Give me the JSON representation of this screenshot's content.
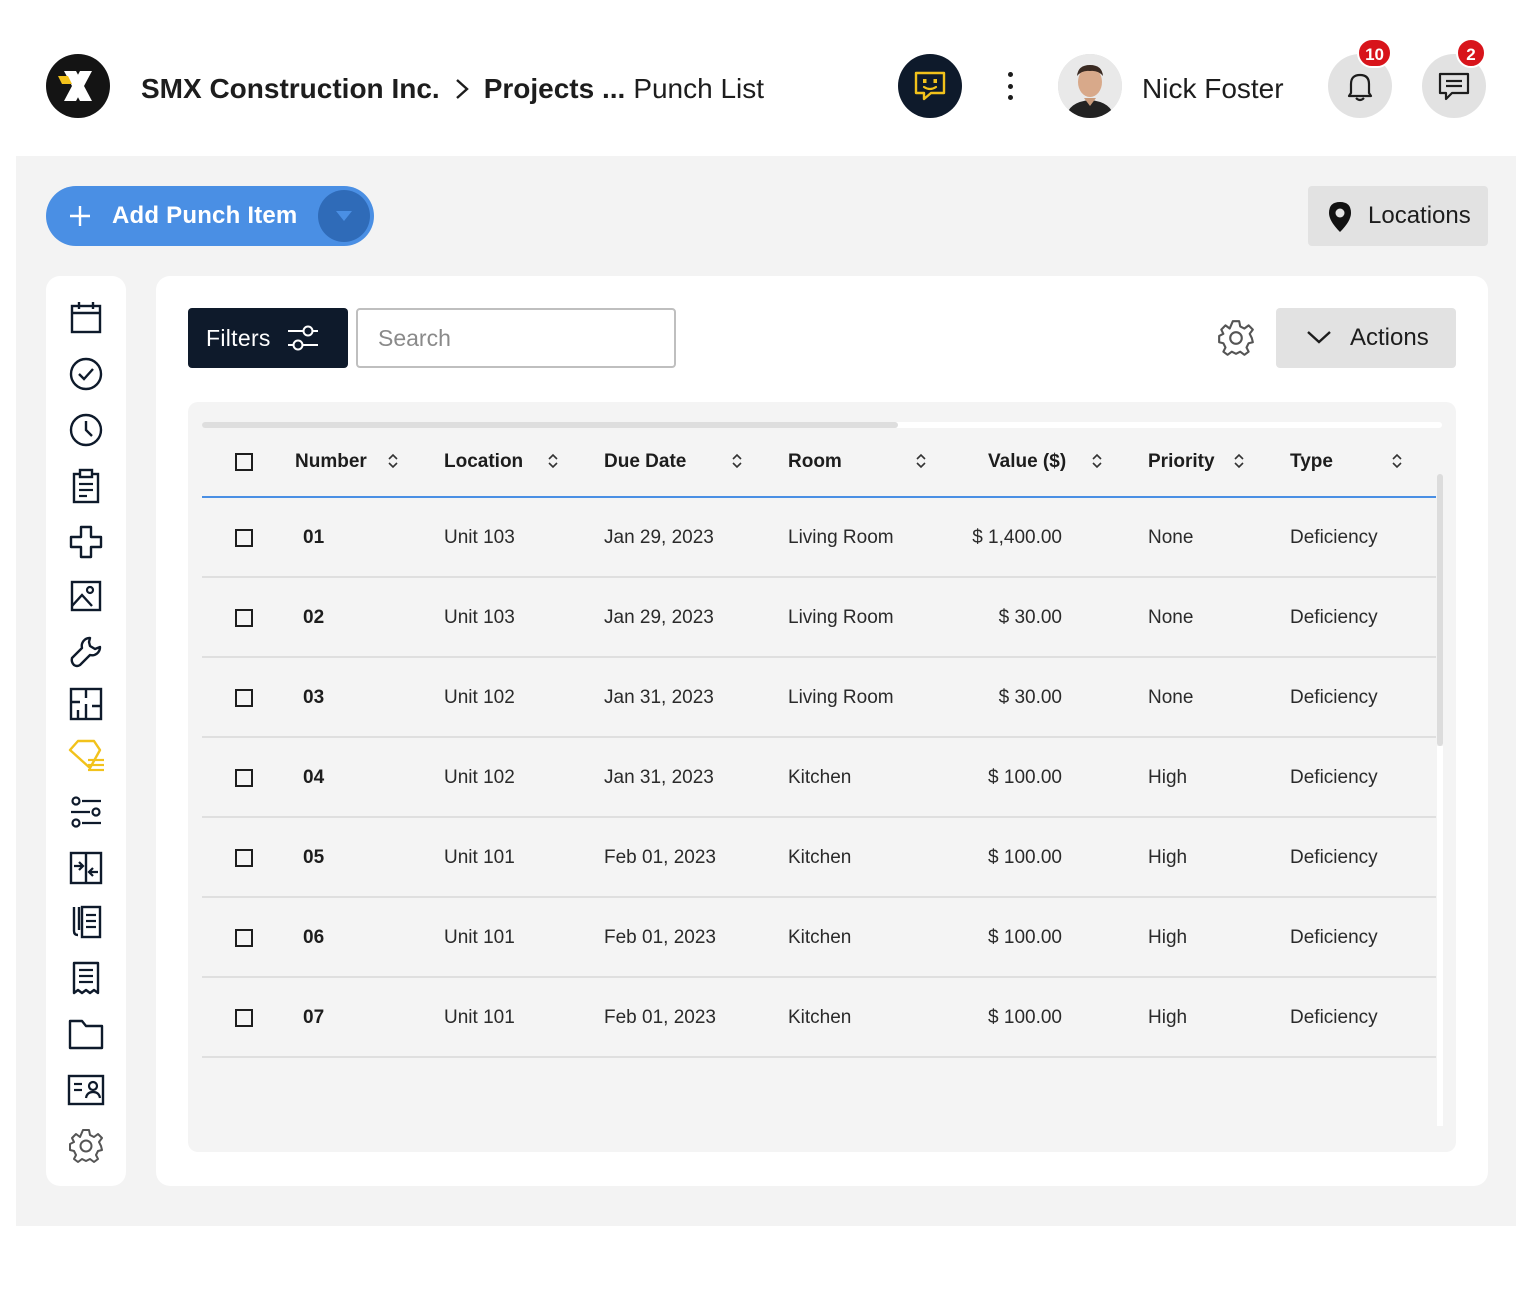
{
  "header": {
    "company": "SMX Construction Inc.",
    "breadcrumb_parent": "Projects ...",
    "breadcrumb_current": "Punch List",
    "user_name": "Nick Foster",
    "notifications_count": "10",
    "messages_count": "2"
  },
  "toolbar": {
    "add_label": "Add Punch Item",
    "locations_label": "Locations",
    "filters_label": "Filters",
    "search_placeholder": "Search",
    "actions_label": "Actions"
  },
  "sidebar": {
    "icons": [
      "calendar-icon",
      "check-circle-icon",
      "clock-icon",
      "clipboard-icon",
      "medical-cross-icon",
      "image-icon",
      "wrench-icon",
      "floor-plan-icon",
      "punch-tag-icon",
      "sliders-icon",
      "compare-icon",
      "documents-icon",
      "receipt-icon",
      "folder-icon",
      "contact-card-icon",
      "settings-icon"
    ],
    "active": "punch-tag-icon"
  },
  "colors": {
    "accent": "#4a8fe4",
    "dark": "#0e1a2b",
    "active_icon": "#f2c21b",
    "badge": "#d8141b"
  },
  "table": {
    "columns": [
      "Number",
      "Location",
      "Due Date",
      "Room",
      "Value ($)",
      "Priority",
      "Type"
    ],
    "rows": [
      {
        "number": "01",
        "location": "Unit 103",
        "due_date": "Jan 29, 2023",
        "room": "Living Room",
        "value": "$ 1,400.00",
        "priority": "None",
        "type": "Deficiency"
      },
      {
        "number": "02",
        "location": "Unit 103",
        "due_date": "Jan 29, 2023",
        "room": "Living Room",
        "value": "$ 30.00",
        "priority": "None",
        "type": "Deficiency"
      },
      {
        "number": "03",
        "location": "Unit 102",
        "due_date": "Jan 31, 2023",
        "room": "Living Room",
        "value": "$ 30.00",
        "priority": "None",
        "type": "Deficiency"
      },
      {
        "number": "04",
        "location": "Unit 102",
        "due_date": "Jan 31, 2023",
        "room": "Kitchen",
        "value": "$ 100.00",
        "priority": "High",
        "type": "Deficiency"
      },
      {
        "number": "05",
        "location": "Unit 101",
        "due_date": "Feb 01, 2023",
        "room": "Kitchen",
        "value": "$ 100.00",
        "priority": "High",
        "type": "Deficiency"
      },
      {
        "number": "06",
        "location": "Unit 101",
        "due_date": "Feb 01, 2023",
        "room": "Kitchen",
        "value": "$ 100.00",
        "priority": "High",
        "type": "Deficiency"
      },
      {
        "number": "07",
        "location": "Unit 101",
        "due_date": "Feb 01, 2023",
        "room": "Kitchen",
        "value": "$ 100.00",
        "priority": "High",
        "type": "Deficiency"
      }
    ]
  }
}
